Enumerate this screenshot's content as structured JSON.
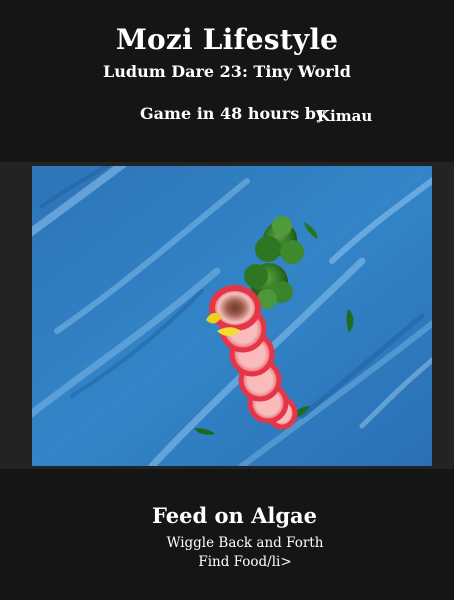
{
  "header": {
    "title": "Mozi Lifestyle",
    "subtitle": "Ludum Dare 23: Tiny World",
    "byline_prefix": "Game in 48 hours by",
    "author": "Kimau"
  },
  "game": {
    "water_color": "#2f7ec0",
    "worm_color": "#e83a4d",
    "algae_color": "#2f7d24",
    "creature_beak_color": "#e8d21c",
    "sprites": [
      "worm",
      "algae-clump",
      "algae-leaf"
    ]
  },
  "footer": {
    "objective": "Feed on Algae",
    "instructions": [
      "Wiggle Back and Forth",
      "Find Food/li>"
    ]
  }
}
